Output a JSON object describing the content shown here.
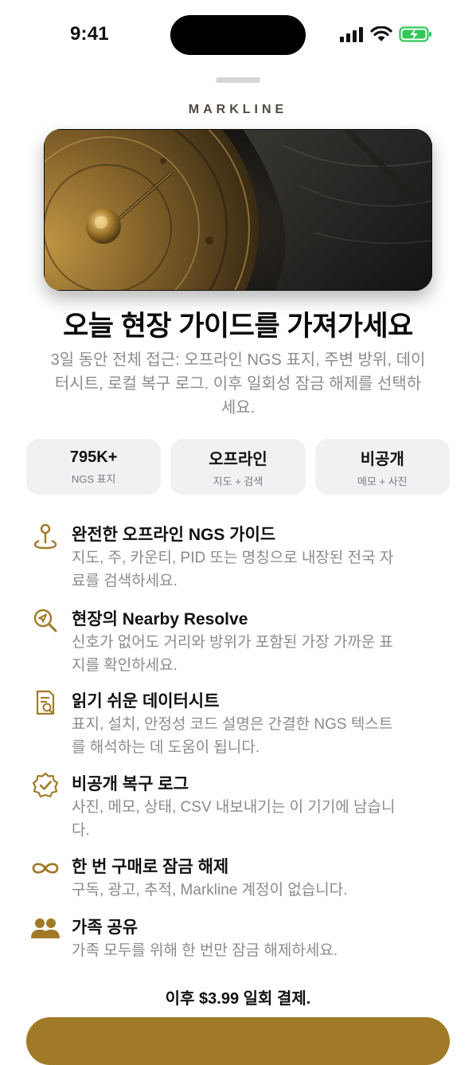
{
  "status": {
    "time": "9:41"
  },
  "brand": "MARKLINE",
  "headline": "오늘 현장 가이드를 가져가세요",
  "subline": "3일 동안 전체 접근: 오프라인 NGS 표지, 주변 방위, 데이터시트, 로컬 복구 로그. 이후 일회성 잠금 해제를 선택하세요.",
  "stats": [
    {
      "value": "795K+",
      "caption": "NGS 표지"
    },
    {
      "value": "오프라인",
      "caption": "지도 + 검색"
    },
    {
      "value": "비공개",
      "caption": "메모 + 사진"
    }
  ],
  "features": [
    {
      "icon": "map-pin-icon",
      "title": "완전한 오프라인 NGS 가이드",
      "desc": "지도, 주, 카운티, PID 또는 명칭으로 내장된 전국 자료를 검색하세요."
    },
    {
      "icon": "location-search-icon",
      "title": "현장의 Nearby Resolve",
      "desc": "신호가 없어도 거리와 방위가 포함된 가장 가까운 표지를 확인하세요."
    },
    {
      "icon": "document-search-icon",
      "title": "읽기 쉬운 데이터시트",
      "desc": "표지, 설치, 안정성 코드 설명은 간결한 NGS 텍스트를 해석하는 데 도움이 됩니다."
    },
    {
      "icon": "verified-badge-icon",
      "title": "비공개 복구 로그",
      "desc": "사진, 메모, 상태, CSV 내보내기는 이 기기에 남습니다."
    },
    {
      "icon": "infinity-icon",
      "title": "한 번 구매로 잠금 해제",
      "desc": "구독, 광고, 추적, Markline 계정이 없습니다."
    },
    {
      "icon": "people-icon",
      "title": "가족 공유",
      "desc": "가족 모두를 위해 한 번만 잠금 해제하세요."
    }
  ],
  "price_note": "이후 $3.99 일회 결제.",
  "colors": {
    "accent": "#a07a26",
    "muted": "#8b8b8f",
    "card": "#f1f1f4"
  }
}
